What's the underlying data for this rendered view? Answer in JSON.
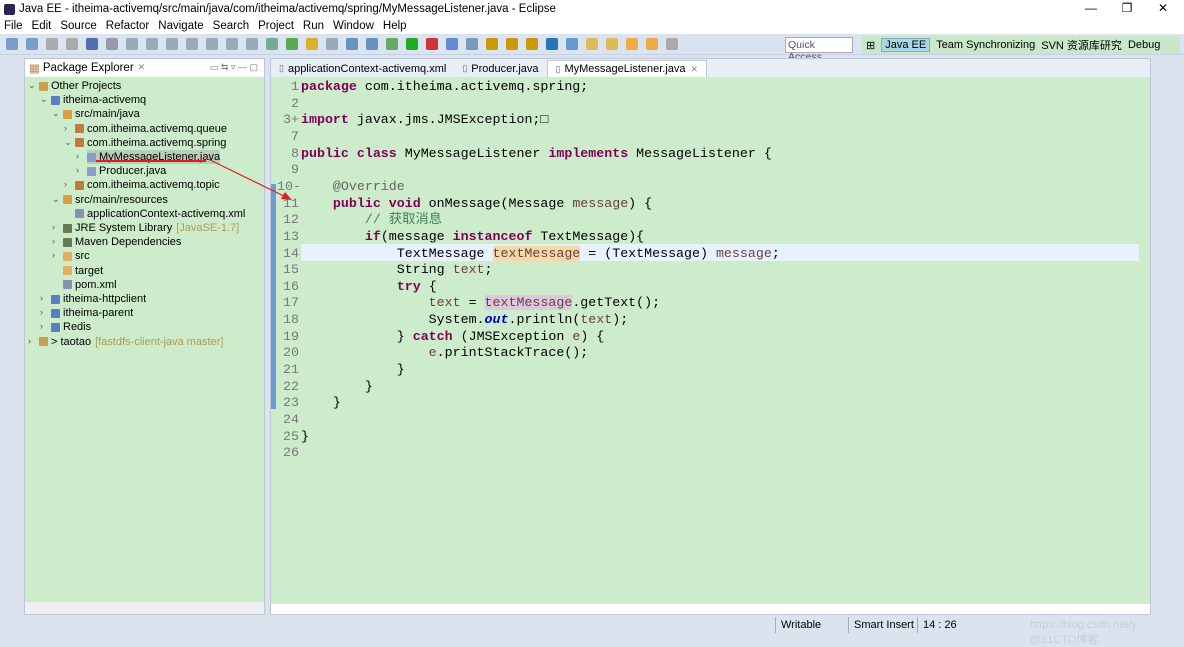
{
  "window": {
    "title": "Java EE - itheima-activemq/src/main/java/com/itheima/activemq/spring/MyMessageListener.java - Eclipse",
    "controls": [
      "—",
      "❐",
      "✕"
    ]
  },
  "menu": [
    "File",
    "Edit",
    "Source",
    "Refactor",
    "Navigate",
    "Search",
    "Project",
    "Run",
    "Window",
    "Help"
  ],
  "toolbar": {
    "quick_access": "Quick Access"
  },
  "perspectives": [
    {
      "label": "Java EE",
      "active": true
    },
    {
      "label": "Team Synchronizing"
    },
    {
      "label": "SVN 资源库研究"
    },
    {
      "label": "Debug"
    }
  ],
  "package_explorer": {
    "title": "Package Explorer",
    "items": [
      {
        "label": "Other Projects",
        "depth": 0,
        "expanded": true,
        "icon": "working-set-icon"
      },
      {
        "label": "itheima-activemq",
        "depth": 1,
        "expanded": true,
        "icon": "project-icon"
      },
      {
        "label": "src/main/java",
        "depth": 2,
        "expanded": true,
        "icon": "source-folder-icon"
      },
      {
        "label": "com.itheima.activemq.queue",
        "depth": 3,
        "expanded": false,
        "icon": "package-icon"
      },
      {
        "label": "com.itheima.activemq.spring",
        "depth": 3,
        "expanded": true,
        "icon": "package-icon"
      },
      {
        "label": "MyMessageListener.java",
        "depth": 4,
        "expanded": false,
        "icon": "java-file-icon",
        "selected": true
      },
      {
        "label": "Producer.java",
        "depth": 4,
        "expanded": false,
        "icon": "java-file-icon"
      },
      {
        "label": "com.itheima.activemq.topic",
        "depth": 3,
        "expanded": false,
        "icon": "package-icon"
      },
      {
        "label": "src/main/resources",
        "depth": 2,
        "expanded": true,
        "icon": "source-folder-icon"
      },
      {
        "label": "applicationContext-activemq.xml",
        "depth": 3,
        "icon": "xml-file-icon"
      },
      {
        "label": "JRE System Library",
        "decoration": "[JavaSE-1.7]",
        "depth": 2,
        "expanded": false,
        "icon": "library-icon"
      },
      {
        "label": "Maven Dependencies",
        "depth": 2,
        "expanded": false,
        "icon": "library-icon"
      },
      {
        "label": "src",
        "depth": 2,
        "expanded": false,
        "icon": "folder-icon"
      },
      {
        "label": "target",
        "depth": 2,
        "icon": "folder-icon"
      },
      {
        "label": "pom.xml",
        "depth": 2,
        "icon": "xml-file-icon"
      },
      {
        "label": "itheima-httpclient",
        "depth": 1,
        "expanded": false,
        "icon": "project-icon"
      },
      {
        "label": "itheima-parent",
        "depth": 1,
        "expanded": false,
        "icon": "project-icon"
      },
      {
        "label": "Redis",
        "depth": 1,
        "expanded": false,
        "icon": "project-icon"
      },
      {
        "label": "> taotao",
        "decoration": "[fastdfs-client-java master]",
        "depth": 0,
        "expanded": false,
        "icon": "working-set-icon"
      }
    ]
  },
  "editor": {
    "tabs": [
      {
        "label": "applicationContext-activemq.xml"
      },
      {
        "label": "Producer.java"
      },
      {
        "label": "MyMessageListener.java",
        "active": true
      }
    ],
    "current_line": "14",
    "lines": [
      {
        "n": "1",
        "t": [
          [
            "package",
            "kw"
          ],
          [
            " com.itheima.activemq.spring;",
            ""
          ]
        ]
      },
      {
        "n": "2",
        "t": []
      },
      {
        "n": "3+",
        "t": [
          [
            "import",
            "kw"
          ],
          [
            " javax.jms.JMSException;□",
            ""
          ]
        ]
      },
      {
        "n": "7",
        "t": []
      },
      {
        "n": "8",
        "t": [
          [
            "public class",
            "kw"
          ],
          [
            " MyMessageListener ",
            ""
          ],
          [
            "implements",
            "kw"
          ],
          [
            " MessageListener {",
            ""
          ]
        ]
      },
      {
        "n": "9",
        "t": []
      },
      {
        "n": "10-",
        "t": [
          [
            "    @Override",
            "an"
          ]
        ]
      },
      {
        "n": "11",
        "t": [
          [
            "    ",
            ""
          ],
          [
            "public void",
            "kw"
          ],
          [
            " onMessage(Message ",
            ""
          ],
          [
            "message",
            "var"
          ],
          [
            ") {",
            ""
          ]
        ]
      },
      {
        "n": "12",
        "t": [
          [
            "        // 获取消息",
            "cm"
          ]
        ]
      },
      {
        "n": "13",
        "t": [
          [
            "        ",
            ""
          ],
          [
            "if",
            "kw"
          ],
          [
            "(message ",
            ""
          ],
          [
            "instanceof",
            "kw"
          ],
          [
            " TextMessage){",
            ""
          ]
        ]
      },
      {
        "n": "14",
        "t": [
          [
            "            TextMessage ",
            ""
          ],
          [
            "textMessage",
            "var hl"
          ],
          [
            " = (TextMessage) ",
            ""
          ],
          [
            "message",
            "var"
          ],
          [
            ";",
            ""
          ]
        ]
      },
      {
        "n": "15",
        "t": [
          [
            "            String ",
            ""
          ],
          [
            "text",
            "var"
          ],
          [
            ";",
            ""
          ]
        ]
      },
      {
        "n": "16",
        "t": [
          [
            "            ",
            ""
          ],
          [
            "try",
            "kw"
          ],
          [
            " {",
            ""
          ]
        ]
      },
      {
        "n": "17",
        "t": [
          [
            "                ",
            ""
          ],
          [
            "text",
            "var"
          ],
          [
            " = ",
            ""
          ],
          [
            "textMessage",
            "var hl2"
          ],
          [
            ".getText();",
            ""
          ]
        ]
      },
      {
        "n": "18",
        "t": [
          [
            "                System.",
            ""
          ],
          [
            "out",
            "fd"
          ],
          [
            ".println(",
            ""
          ],
          [
            "text",
            "var"
          ],
          [
            ");",
            ""
          ]
        ]
      },
      {
        "n": "19",
        "t": [
          [
            "            } ",
            ""
          ],
          [
            "catch",
            "kw"
          ],
          [
            " (JMSException ",
            ""
          ],
          [
            "e",
            "var"
          ],
          [
            ") {",
            ""
          ]
        ]
      },
      {
        "n": "20",
        "t": [
          [
            "                ",
            ""
          ],
          [
            "e",
            "var"
          ],
          [
            ".printStackTrace();",
            ""
          ]
        ]
      },
      {
        "n": "21",
        "t": [
          [
            "            }",
            ""
          ]
        ]
      },
      {
        "n": "22",
        "t": [
          [
            "        }",
            ""
          ]
        ]
      },
      {
        "n": "23",
        "t": [
          [
            "    }",
            ""
          ]
        ]
      },
      {
        "n": "24",
        "t": []
      },
      {
        "n": "25",
        "t": [
          [
            "}",
            ""
          ]
        ]
      },
      {
        "n": "26",
        "t": []
      }
    ]
  },
  "status": {
    "writable": "Writable",
    "insert_mode": "Smart Insert",
    "position": "14 : 26",
    "watermark": "https://blog.csdn.net/y @51CTO博客"
  },
  "colors": {
    "code_bg": "#cceccc",
    "keyword": "#7f0055",
    "comment": "#3f7f5f",
    "annotation_arrow": "#e02020"
  }
}
